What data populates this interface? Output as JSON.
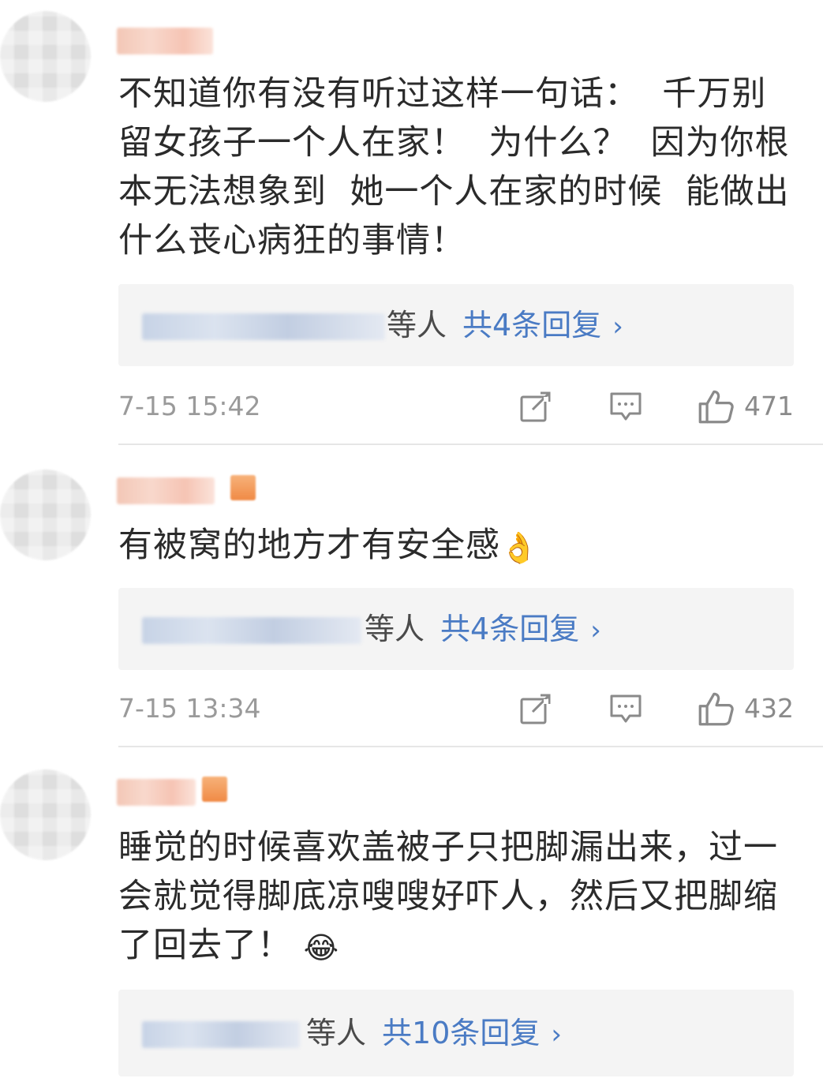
{
  "comments": [
    {
      "text": "不知道你有没有听过这样一句话：  千万别留女孩子一个人在家！  为什么？  因为你根本无法想象到  她一个人在家的时候  能做出什么丧心病狂的事情！",
      "reply_tail": "等人",
      "reply_count": "共4条回复",
      "reply_chevron": "›",
      "time": "7-15 15:42",
      "likes": "471",
      "emoji": ""
    },
    {
      "text": "有被窝的地方才有安全感",
      "emoji": "👌",
      "reply_tail": "等人",
      "reply_count": "共4条回复",
      "reply_chevron": "›",
      "time": "7-15 13:34",
      "likes": "432"
    },
    {
      "text": "睡觉的时候喜欢盖被子只把脚漏出来，过一会就觉得脚底凉嗖嗖好吓人，然后又把脚缩了回去了！",
      "emoji": "😂",
      "reply_tail": "等人",
      "reply_count": "共10条回复",
      "reply_chevron": "›"
    }
  ],
  "icons": {
    "share": "share-icon",
    "comment": "comment-icon",
    "like": "like-icon"
  },
  "colors": {
    "link_blue": "#4a7bc4",
    "meta_gray": "#9a9a9a",
    "reply_bg": "#f4f4f4"
  }
}
